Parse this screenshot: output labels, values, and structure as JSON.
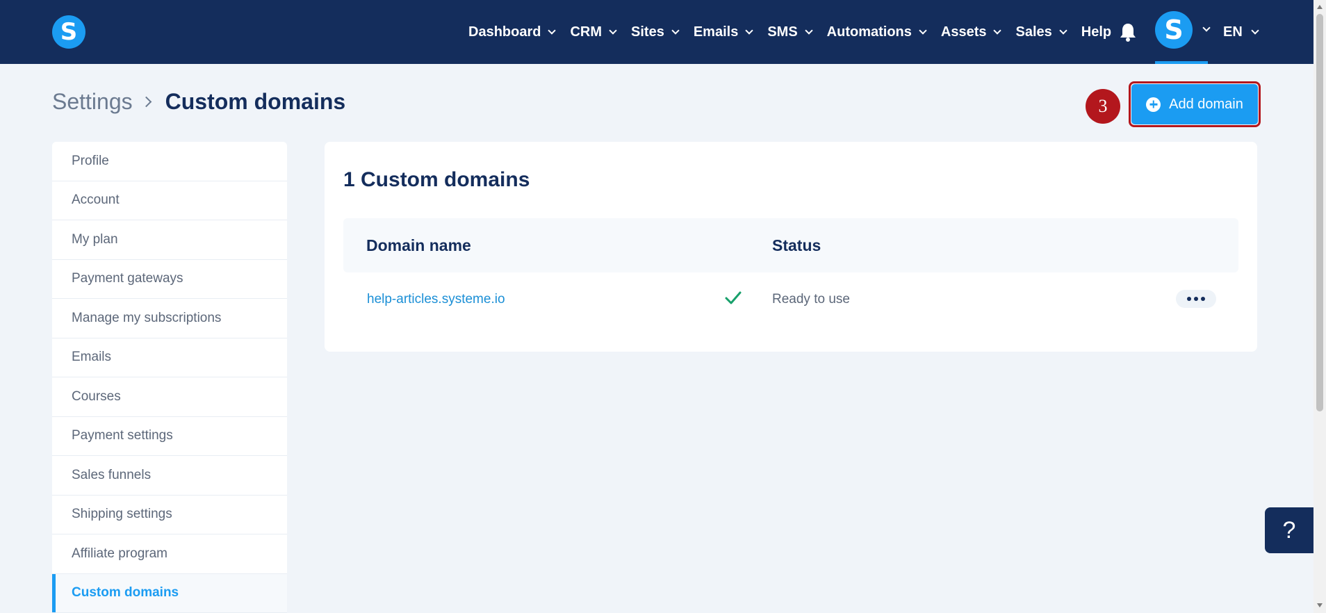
{
  "header": {
    "logo_letter": "S",
    "nav": [
      {
        "label": "Dashboard",
        "dropdown": true
      },
      {
        "label": "CRM",
        "dropdown": true
      },
      {
        "label": "Sites",
        "dropdown": true
      },
      {
        "label": "Emails",
        "dropdown": true
      },
      {
        "label": "SMS",
        "dropdown": true
      },
      {
        "label": "Automations",
        "dropdown": true
      },
      {
        "label": "Assets",
        "dropdown": true
      },
      {
        "label": "Sales",
        "dropdown": true
      },
      {
        "label": "Help",
        "dropdown": false
      }
    ],
    "notification_icon": "bell-icon",
    "avatar_letter": "S",
    "language": "EN"
  },
  "breadcrumb": {
    "parent": "Settings",
    "current": "Custom domains"
  },
  "step_badge": "3",
  "actions": {
    "add_domain_label": "Add domain"
  },
  "sidebar": {
    "items": [
      {
        "label": "Profile",
        "active": false
      },
      {
        "label": "Account",
        "active": false
      },
      {
        "label": "My plan",
        "active": false
      },
      {
        "label": "Payment gateways",
        "active": false
      },
      {
        "label": "Manage my subscriptions",
        "active": false
      },
      {
        "label": "Emails",
        "active": false
      },
      {
        "label": "Courses",
        "active": false
      },
      {
        "label": "Payment settings",
        "active": false
      },
      {
        "label": "Sales funnels",
        "active": false
      },
      {
        "label": "Shipping settings",
        "active": false
      },
      {
        "label": "Affiliate program",
        "active": false
      },
      {
        "label": "Custom domains",
        "active": true
      }
    ]
  },
  "main": {
    "title": "1 Custom domains",
    "columns": {
      "domain": "Domain name",
      "status": "Status"
    },
    "rows": [
      {
        "domain": "help-articles.systeme.io",
        "status": "Ready to use",
        "status_icon": "check-icon"
      }
    ]
  },
  "help_button": "?",
  "colors": {
    "nav_bg": "#142d5c",
    "accent": "#1b9cf2",
    "page_bg": "#f0f4f9",
    "highlight": "#b3171d",
    "success": "#18a06b"
  }
}
